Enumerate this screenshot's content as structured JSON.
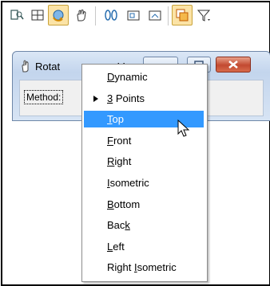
{
  "toolbar": {
    "icons": [
      "select-view-icon",
      "fit-view-icon",
      "rotate-view-icon",
      "pan-view-icon",
      "walk-view-icon",
      "window-area-icon",
      "copy-view-icon",
      "view-attributes-icon",
      "view-filter-icon"
    ],
    "active_icon": "rotate-view-icon"
  },
  "dialog": {
    "title": "Rotat",
    "title_tail": "V",
    "method_label": "Method:"
  },
  "menu": {
    "items": [
      {
        "pre": "",
        "mn": "D",
        "post": "ynamic"
      },
      {
        "pre": "",
        "mn": "3",
        "post": " Points",
        "bullet": true
      },
      {
        "pre": "",
        "mn": "T",
        "post": "op",
        "selected": true
      },
      {
        "pre": "",
        "mn": "F",
        "post": "ront"
      },
      {
        "pre": "",
        "mn": "R",
        "post": "ight"
      },
      {
        "pre": "",
        "mn": "I",
        "post": "sometric"
      },
      {
        "pre": "",
        "mn": "B",
        "post": "ottom"
      },
      {
        "pre": "Bac",
        "mn": "k",
        "post": ""
      },
      {
        "pre": "",
        "mn": "L",
        "post": "eft"
      },
      {
        "pre": "Right ",
        "mn": "I",
        "post": "sometric"
      }
    ]
  },
  "colors": {
    "highlight": "#3399ff",
    "active_tool": "#fbe3a6",
    "close_button": "#c24a31"
  }
}
